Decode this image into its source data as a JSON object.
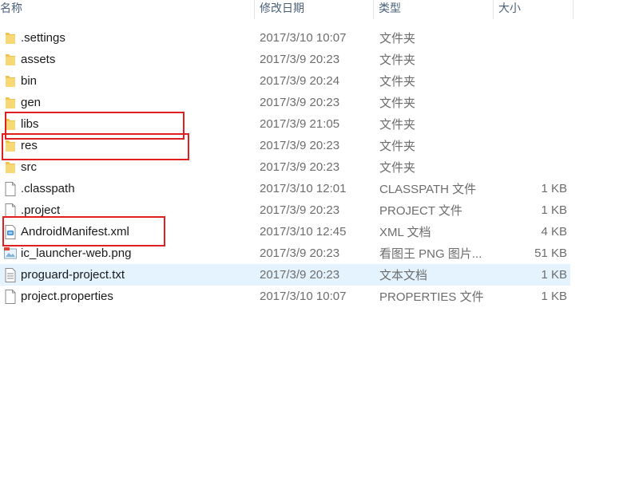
{
  "header": {
    "name": "名称",
    "date": "修改日期",
    "type": "类型",
    "size": "大小"
  },
  "files": [
    {
      "name": ".settings",
      "date": "2017/3/10 10:07",
      "type": "文件夹",
      "size": "",
      "icon": "folder-icon"
    },
    {
      "name": "assets",
      "date": "2017/3/9 20:23",
      "type": "文件夹",
      "size": "",
      "icon": "folder-icon"
    },
    {
      "name": "bin",
      "date": "2017/3/9 20:24",
      "type": "文件夹",
      "size": "",
      "icon": "folder-icon"
    },
    {
      "name": "gen",
      "date": "2017/3/9 20:23",
      "type": "文件夹",
      "size": "",
      "icon": "folder-icon"
    },
    {
      "name": "libs",
      "date": "2017/3/9 21:05",
      "type": "文件夹",
      "size": "",
      "icon": "folder-icon"
    },
    {
      "name": "res",
      "date": "2017/3/9 20:23",
      "type": "文件夹",
      "size": "",
      "icon": "folder-icon"
    },
    {
      "name": "src",
      "date": "2017/3/9 20:23",
      "type": "文件夹",
      "size": "",
      "icon": "folder-icon"
    },
    {
      "name": ".classpath",
      "date": "2017/3/10 12:01",
      "type": "CLASSPATH 文件",
      "size": "1 KB",
      "icon": "file-icon"
    },
    {
      "name": ".project",
      "date": "2017/3/9 20:23",
      "type": "PROJECT 文件",
      "size": "1 KB",
      "icon": "file-icon"
    },
    {
      "name": "AndroidManifest.xml",
      "date": "2017/3/10 12:45",
      "type": "XML 文档",
      "size": "4 KB",
      "icon": "xml-file-icon"
    },
    {
      "name": "ic_launcher-web.png",
      "date": "2017/3/9 20:23",
      "type": "看图王 PNG 图片...",
      "size": "51 KB",
      "icon": "image-file-icon"
    },
    {
      "name": "proguard-project.txt",
      "date": "2017/3/9 20:23",
      "type": "文本文档",
      "size": "1 KB",
      "icon": "text-file-icon",
      "selected": true
    },
    {
      "name": "project.properties",
      "date": "2017/3/10 10:07",
      "type": "PROPERTIES 文件",
      "size": "1 KB",
      "icon": "file-icon"
    }
  ],
  "colors": {
    "selection": "#e5f3ff",
    "annotation": "#e02020",
    "folder": "#f2c14e"
  }
}
